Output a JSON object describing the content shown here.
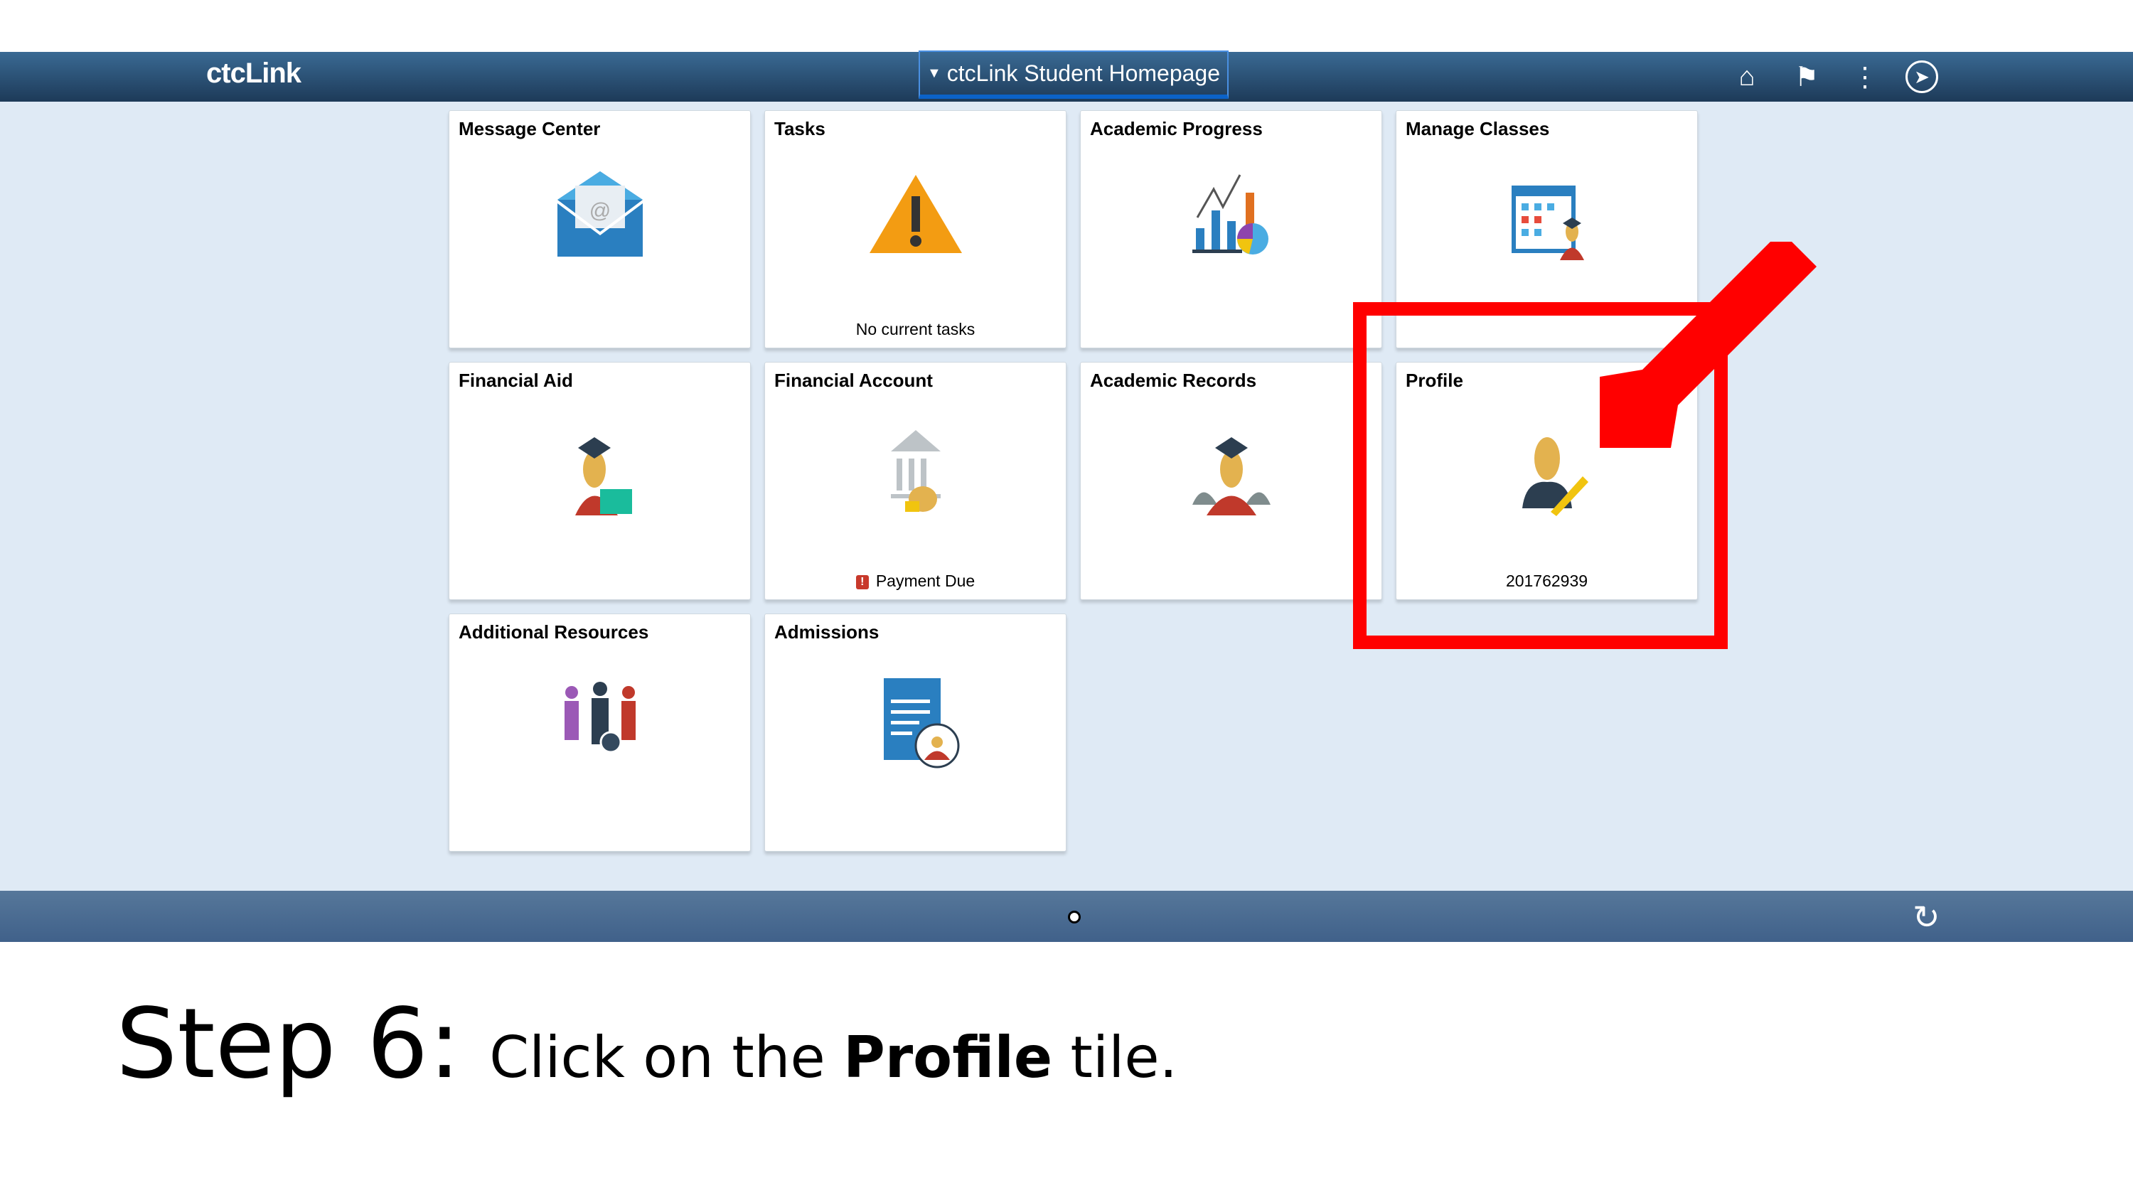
{
  "header": {
    "logo": "ctcLink",
    "title": "ctcLink Student Homepage",
    "icons": [
      "home-icon",
      "flag-icon",
      "more-vertical-icon",
      "compass-icon"
    ]
  },
  "tiles": [
    {
      "title": "Message Center",
      "icon": "envelope-icon"
    },
    {
      "title": "Tasks",
      "icon": "warning-icon",
      "subtitle": "No current tasks"
    },
    {
      "title": "Academic Progress",
      "icon": "chart-icon"
    },
    {
      "title": "Manage Classes",
      "icon": "calendar-student-icon"
    },
    {
      "title": "Financial Aid",
      "icon": "graduate-money-icon"
    },
    {
      "title": "Financial Account",
      "icon": "bank-icon",
      "subtitle": "Payment Due",
      "badge": "!"
    },
    {
      "title": "Academic Records",
      "icon": "graduates-icon"
    },
    {
      "title": "Profile",
      "icon": "user-edit-icon",
      "subtitle": "201762939"
    },
    {
      "title": "Additional Resources",
      "icon": "people-gear-icon"
    },
    {
      "title": "Admissions",
      "icon": "document-student-icon"
    }
  ],
  "instruction": {
    "step": "Step 6:",
    "pre": "Click on the ",
    "bold": "Profile",
    "post": " tile."
  },
  "colors": {
    "highlight": "#ff0000",
    "header": "#2b4f74",
    "background": "#dfeaf5"
  }
}
